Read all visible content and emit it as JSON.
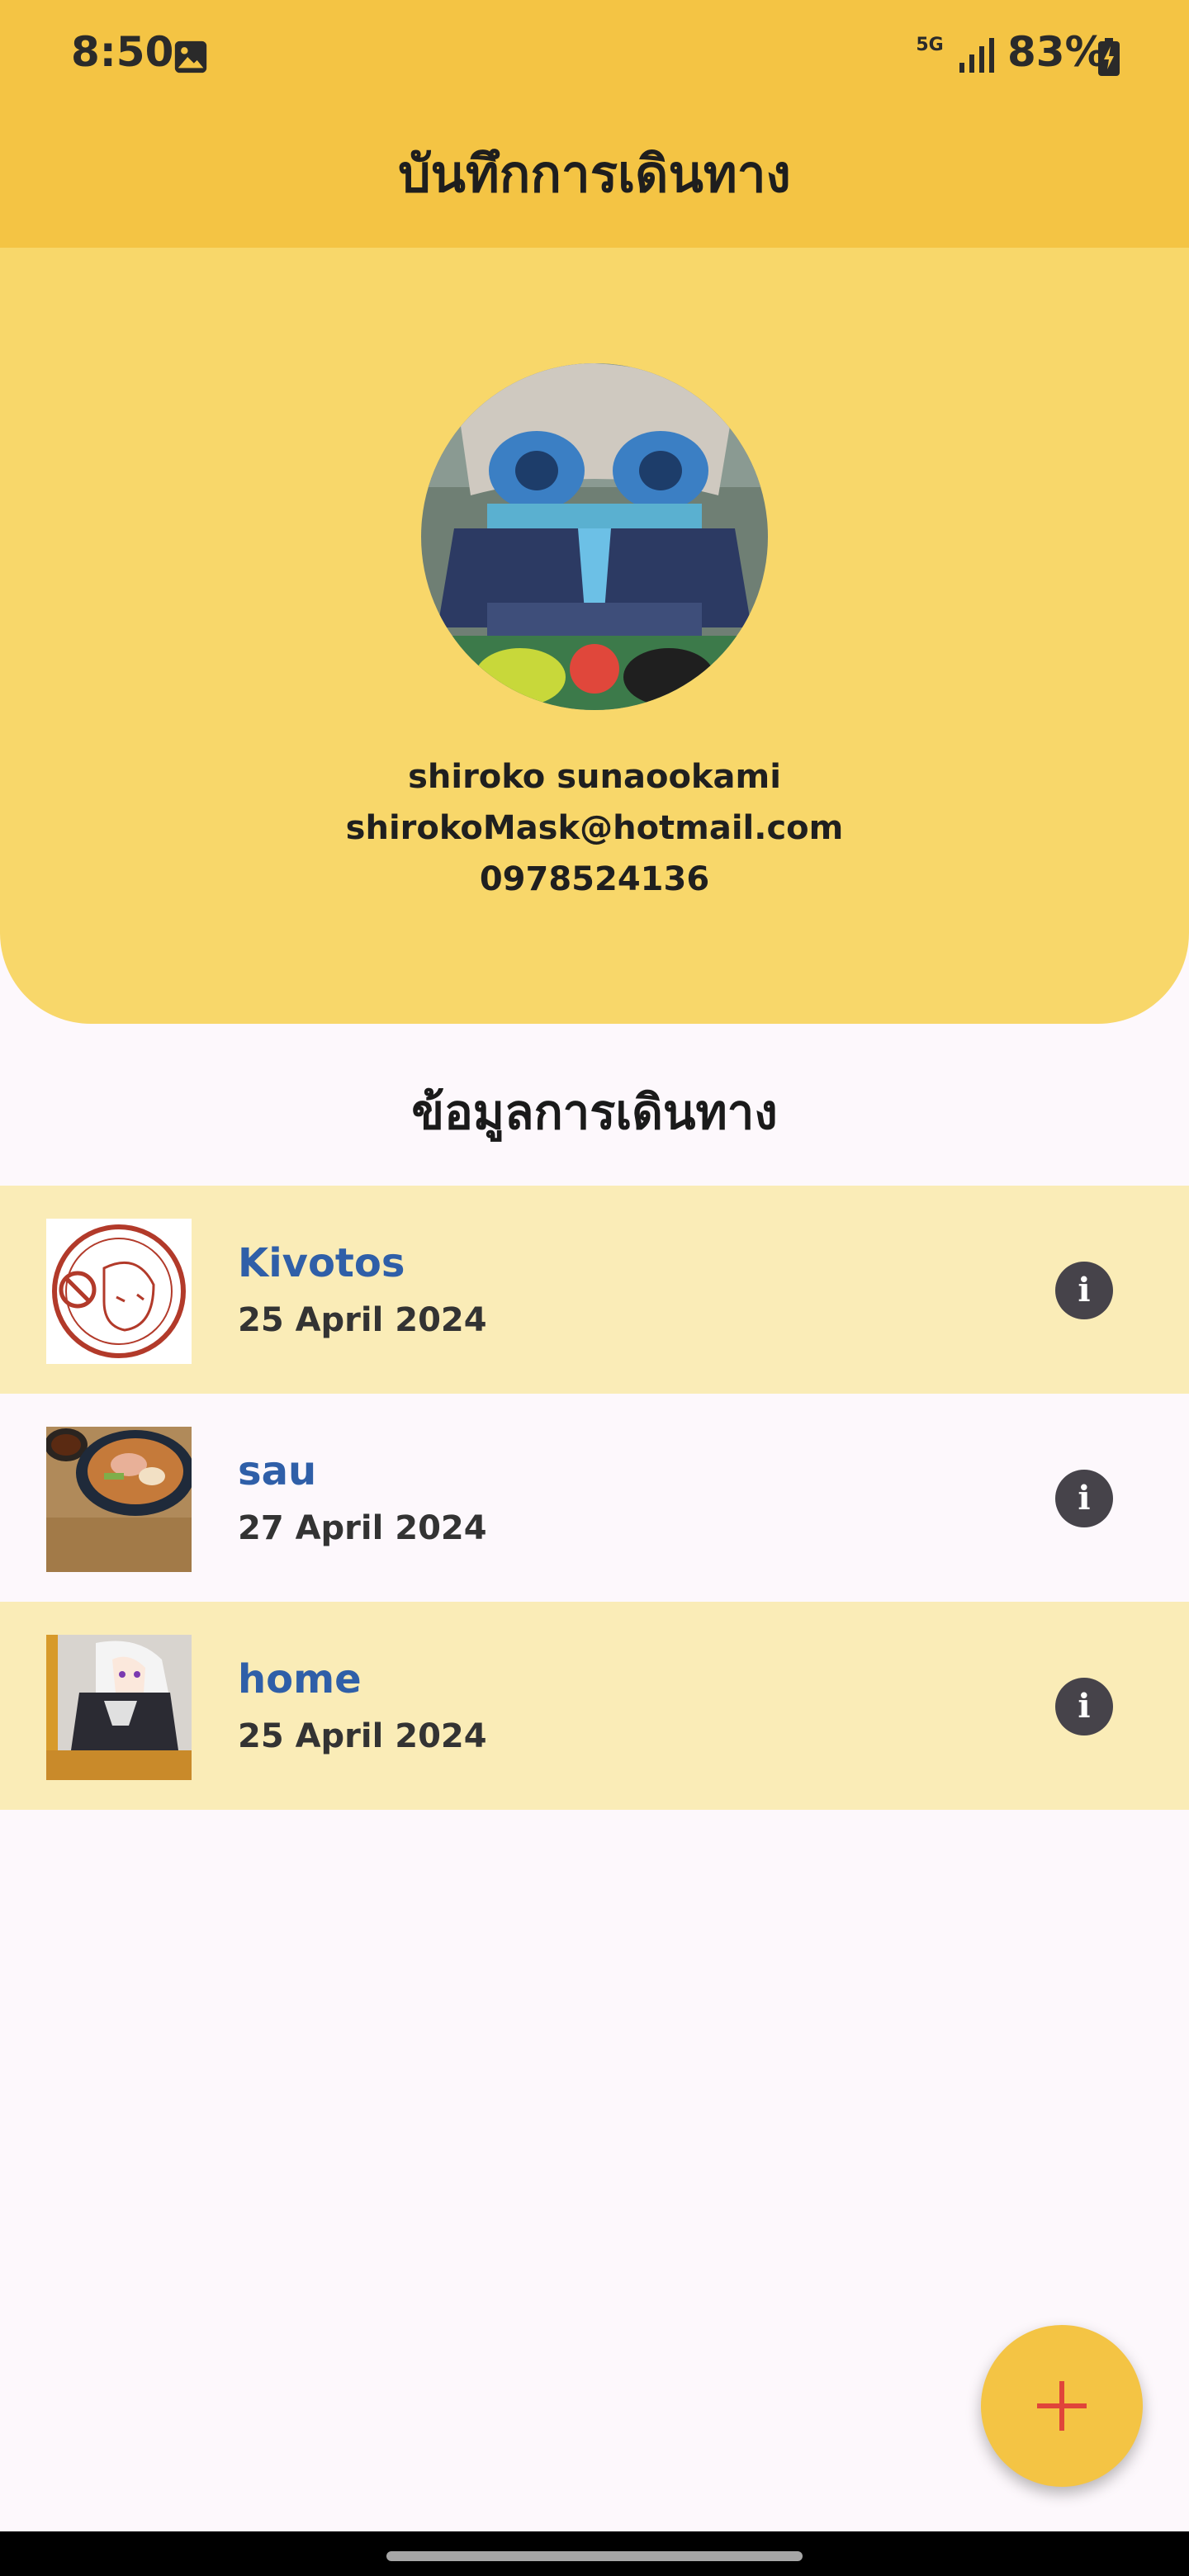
{
  "status_bar": {
    "time": "8:50",
    "network": "5G",
    "battery": "83%",
    "icons": [
      "image-icon",
      "signal-icon",
      "battery-charging-icon"
    ]
  },
  "app_bar": {
    "title": "บันทึกการเดินทาง",
    "color": "#f4c444"
  },
  "profile": {
    "name": "shiroko sunaookami",
    "email": "shirokoMask@hotmail.com",
    "phone": "0978524136",
    "panel_color": "#f8d76a"
  },
  "section": {
    "title": "ข้อมูลการเดินทาง"
  },
  "trips": [
    {
      "name": "Kivotos",
      "date": "25 April 2024",
      "thumb": "stamp-logo"
    },
    {
      "name": "sau",
      "date": "27 April 2024",
      "thumb": "ramen-bowl"
    },
    {
      "name": "home",
      "date": "25 April 2024",
      "thumb": "anime-character"
    }
  ],
  "info_glyph": "i",
  "colors": {
    "row_highlight": "#faecb7",
    "trip_name": "#2f5fa8",
    "fab": "#f4c444",
    "fab_icon": "#e0453a"
  }
}
